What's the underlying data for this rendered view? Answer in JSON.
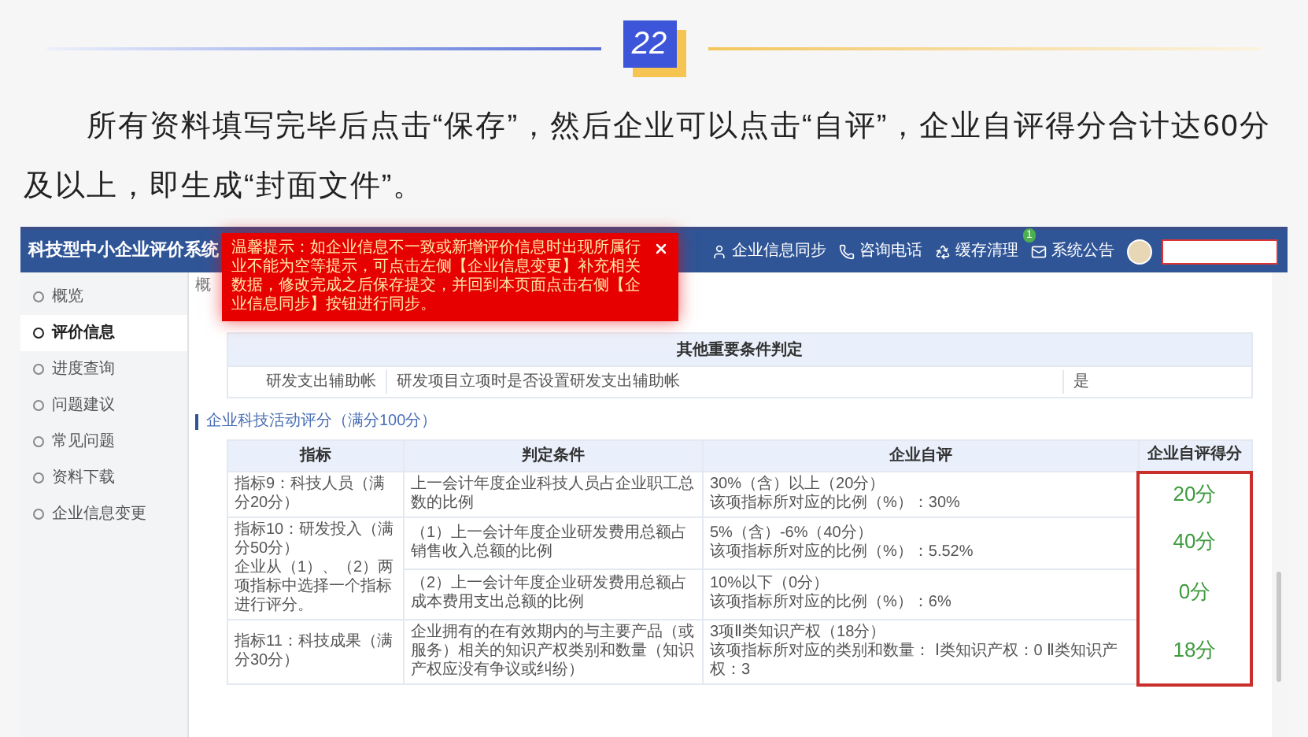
{
  "article": {
    "badge": "22",
    "paragraph": "所有资料填写完毕后点击“保存”，然后企业可以点击“自评”，企业自评得分合计达60分及以上，即生成“封面文件”。"
  },
  "app": {
    "title": "科技型中小企业评价系统",
    "notice": "温馨提示：如企业信息不一致或新增评价信息时出现所属行业不能为空等提示，可点击左侧【企业信息变更】补充相关数据，修改完成之后保存提交，并回到本页面点击右侧【企业信息同步】按钮进行同步。",
    "nav": [
      {
        "label": "企业信息同步"
      },
      {
        "label": "咨询电话"
      },
      {
        "label": "缓存清理"
      },
      {
        "label": "系统公告",
        "badge": "1"
      }
    ],
    "sidebar": {
      "items": [
        {
          "label": "概览",
          "selected": false
        },
        {
          "label": "评价信息",
          "selected": true
        },
        {
          "label": "进度查询",
          "selected": false
        },
        {
          "label": "问题建议",
          "selected": false
        },
        {
          "label": "常见问题",
          "selected": false
        },
        {
          "label": "资料下载",
          "selected": false
        },
        {
          "label": "企业信息变更",
          "selected": false
        }
      ]
    },
    "breadcrumb": "概",
    "conditions": {
      "title": "其他重要条件判定",
      "rows": [
        {
          "name": "研发支出辅助帐",
          "condition": "研发项目立项时是否设置研发支出辅助帐",
          "value": "是"
        }
      ]
    },
    "section_title": "企业科技活动评分（满分100分）",
    "score_table": {
      "columns": [
        "指标",
        "判定条件",
        "企业自评",
        "企业自评得分"
      ],
      "groups": [
        {
          "indicator": "指标9：科技人员（满分20分）",
          "rows": [
            {
              "condition": "上一会计年度企业科技人员占企业职工总数的比例",
              "level_text": "30%（含）以上（20分）",
              "detail": "该项指标所对应的比例（%）：30%",
              "score": "20分"
            }
          ]
        },
        {
          "indicator": "指标10：研发投入（满分50分）",
          "note": "企业从（1）、（2）两项指标中选择一个指标进行评分。",
          "rows": [
            {
              "condition": "（1）上一会计年度企业研发费用总额占销售收入总额的比例",
              "level_text": "5%（含）-6%（40分）",
              "detail": "该项指标所对应的比例（%）：5.52%",
              "score": "40分"
            },
            {
              "condition": "（2）上一会计年度企业研发费用总额占成本费用支出总额的比例",
              "level_text": "10%以下（0分）",
              "detail": "该项指标所对应的比例（%）：6%",
              "score": "0分"
            }
          ]
        },
        {
          "indicator": "指标11：科技成果（满分30分）",
          "rows": [
            {
              "condition": "企业拥有的在有效期内的与主要产品（或服务）相关的知识产权类别和数量（知识产权应没有争议或纠纷）",
              "level_text": "3项Ⅱ类知识产权（18分）",
              "detail": "该项指标所对应的类别和数量： Ⅰ类知识产权：0 Ⅱ类知识产权：3",
              "score": "18分"
            }
          ]
        }
      ]
    }
  }
}
